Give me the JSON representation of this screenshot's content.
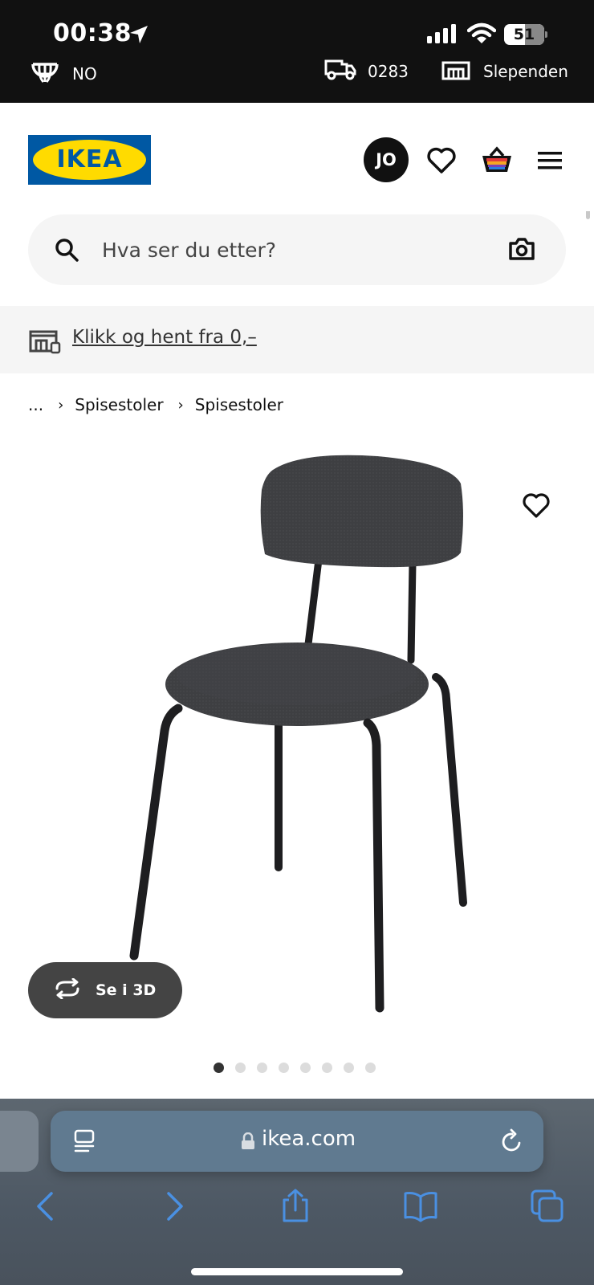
{
  "status_bar": {
    "time": "00:38",
    "battery": "51"
  },
  "utility": {
    "language": "NO",
    "zip": "0283",
    "store": "Slependen"
  },
  "header": {
    "logo_text": "IKEA",
    "avatar_initials": "JO",
    "icons": [
      "heart-icon",
      "basket-icon",
      "hamburger-menu-icon"
    ]
  },
  "search": {
    "placeholder": "Hva ser du etter?"
  },
  "promo": {
    "text": "Klikk og hent fra 0,–"
  },
  "breadcrumb": {
    "items": [
      "...",
      "Spisestoler",
      "Spisestoler"
    ]
  },
  "product": {
    "see_3d_label": "Se i 3D",
    "image_count": 8,
    "active_image": 1
  },
  "browser": {
    "domain": "ikea.com"
  },
  "colors": {
    "ikea_blue": "#0058a3",
    "ikea_yellow": "#ffdb00",
    "status_bar_bg": "#111111",
    "chrome_accent": "#4a90e2"
  }
}
